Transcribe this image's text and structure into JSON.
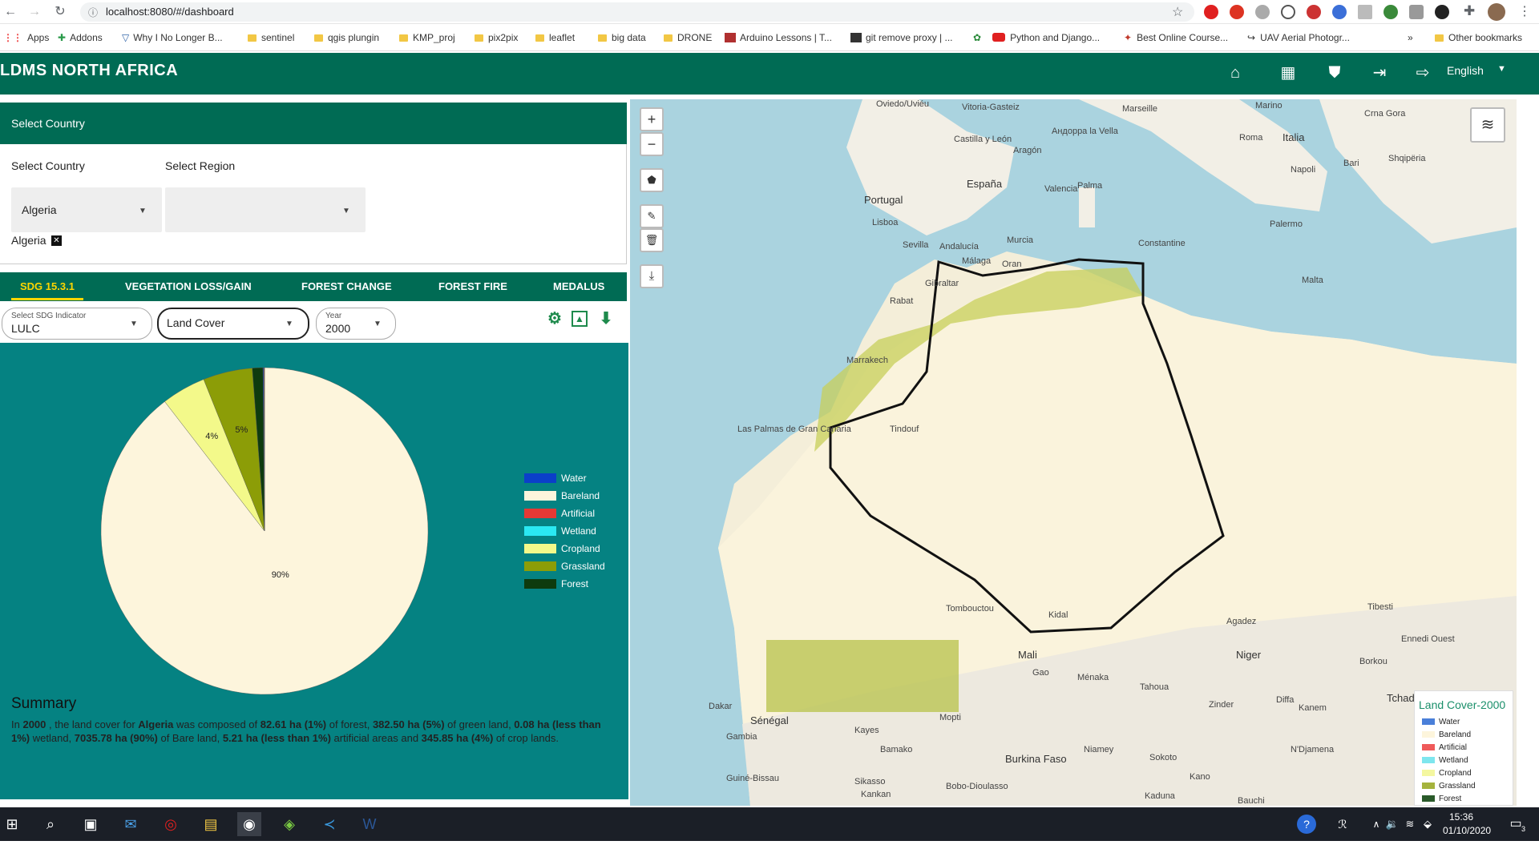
{
  "browser": {
    "url": "localhost:8080/#/dashboard",
    "bookmarks": [
      "Apps",
      "Addons",
      "Why I No Longer B...",
      "sentinel",
      "qgis plungin",
      "KMP_proj",
      "pix2pix",
      "leaflet",
      "big data",
      "DRONE",
      "Arduino Lessons | T...",
      "git remove proxy | ...",
      "Python and Django...",
      "Best Online Course...",
      "UAV Aerial Photogr..."
    ],
    "other_bookmarks": "Other bookmarks",
    "overflow": "»"
  },
  "app": {
    "title": "LDMS NORTH AFRICA",
    "language": "English",
    "header_icons": [
      "home-icon",
      "dashboard-icon",
      "shield-icon",
      "login-icon",
      "logout-icon"
    ]
  },
  "select_panel": {
    "header": "Select Country",
    "country_label": "Select Country",
    "region_label": "Select Region",
    "country_value": "Algeria",
    "region_value": "",
    "chip": "Algeria"
  },
  "tabs": [
    "SDG 15.3.1",
    "VEGETATION LOSS/GAIN",
    "FOREST CHANGE",
    "FOREST FIRE",
    "MEDALUS"
  ],
  "active_tab": 0,
  "controls": {
    "indicator_label": "Select SDG Indicator",
    "indicator_value": "LULC",
    "land_cover": "Land Cover",
    "year_label": "Year",
    "year_value": "2000"
  },
  "chart_data": {
    "type": "pie",
    "series": [
      {
        "name": "Water",
        "value": 0.08,
        "color": "#0b3fc9"
      },
      {
        "name": "Bareland",
        "value": 90,
        "color": "#fdf5dc"
      },
      {
        "name": "Artificial",
        "value": 0.06,
        "color": "#e53935"
      },
      {
        "name": "Wetland",
        "value": 0.01,
        "color": "#2ae8f2"
      },
      {
        "name": "Cropland",
        "value": 4.4,
        "color": "#f3f98a"
      },
      {
        "name": "Grassland",
        "value": 4.9,
        "color": "#8c9d07"
      },
      {
        "name": "Forest",
        "value": 1.05,
        "color": "#0e3b0e"
      }
    ],
    "data_labels": [
      "90%",
      "4%",
      "5%"
    ]
  },
  "summary": {
    "title": "Summary",
    "parts": [
      {
        "t": "In ",
        "b": false
      },
      {
        "t": "2000",
        "b": true
      },
      {
        "t": " , the land cover for ",
        "b": false
      },
      {
        "t": "Algeria",
        "b": true
      },
      {
        "t": " was composed of ",
        "b": false
      },
      {
        "t": "82.61 ha (1%)",
        "b": true
      },
      {
        "t": " of forest, ",
        "b": false
      },
      {
        "t": "382.50 ha (5%)",
        "b": true
      },
      {
        "t": " of green land, ",
        "b": false
      },
      {
        "t": "0.08 ha (less than 1%)",
        "b": true
      },
      {
        "t": " wetland, ",
        "b": false
      },
      {
        "t": "7035.78 ha (90%)",
        "b": true
      },
      {
        "t": " of Bare land, ",
        "b": false
      },
      {
        "t": "5.21 ha (less than 1%)",
        "b": true
      },
      {
        "t": " artificial areas and ",
        "b": false
      },
      {
        "t": "345.85 ha (4%)",
        "b": true
      },
      {
        "t": " of crop lands.",
        "b": false
      }
    ]
  },
  "map": {
    "labels": [
      "Oviedo/Uviéu",
      "Vitoria-Gasteiz",
      "Marseille",
      "Marino",
      "Crna Gora",
      "Андорра la Vella",
      "Roma",
      "Italia",
      "Shqipëria",
      "Castilla y León",
      "Aragón",
      "Bari",
      "Portugal",
      "España",
      "Valencia",
      "Palma",
      "Napoli",
      "Lisboa",
      "Sevilla",
      "Andalucía",
      "Murcia",
      "Palermo",
      "Constantine",
      "Málaga",
      "Oran",
      "Gibraltar",
      "Malta",
      "Rabat",
      "Marrakech",
      "Las Palmas de Gran Canaria",
      "Tindouf",
      "Tombouctou",
      "Kidal",
      "Agadez",
      "Niger",
      "Mali",
      "Gao",
      "Ménaka",
      "Tahoua",
      "Tibesti",
      "Ennedi Ouest",
      "Borkou",
      "Tchad",
      "Dakar",
      "Sénégal",
      "Gambia",
      "Kayes",
      "Bamako",
      "Burkina Faso",
      "Niamey",
      "Sokoto",
      "N'Djamena",
      "Kano",
      "Guiné-Bissau",
      "Sikasso",
      "Bobo-Dioulasso",
      "Kaduna",
      "Bauchi",
      "Zinder",
      "Diffa",
      "Kanem",
      "Mopti",
      "Kankan"
    ],
    "legend_title": "Land Cover-2000",
    "legend": [
      {
        "name": "Water",
        "color": "#4a7fd9"
      },
      {
        "name": "Bareland",
        "color": "#fdf5dc"
      },
      {
        "name": "Artificial",
        "color": "#ef5a5a"
      },
      {
        "name": "Wetland",
        "color": "#7ee6ee"
      },
      {
        "name": "Cropland",
        "color": "#f4f7a0"
      },
      {
        "name": "Grassland",
        "color": "#a5b33d"
      },
      {
        "name": "Forest",
        "color": "#2a5a2a"
      }
    ]
  },
  "taskbar": {
    "time": "15:36",
    "date": "01/10/2020",
    "notification_count": "3"
  }
}
